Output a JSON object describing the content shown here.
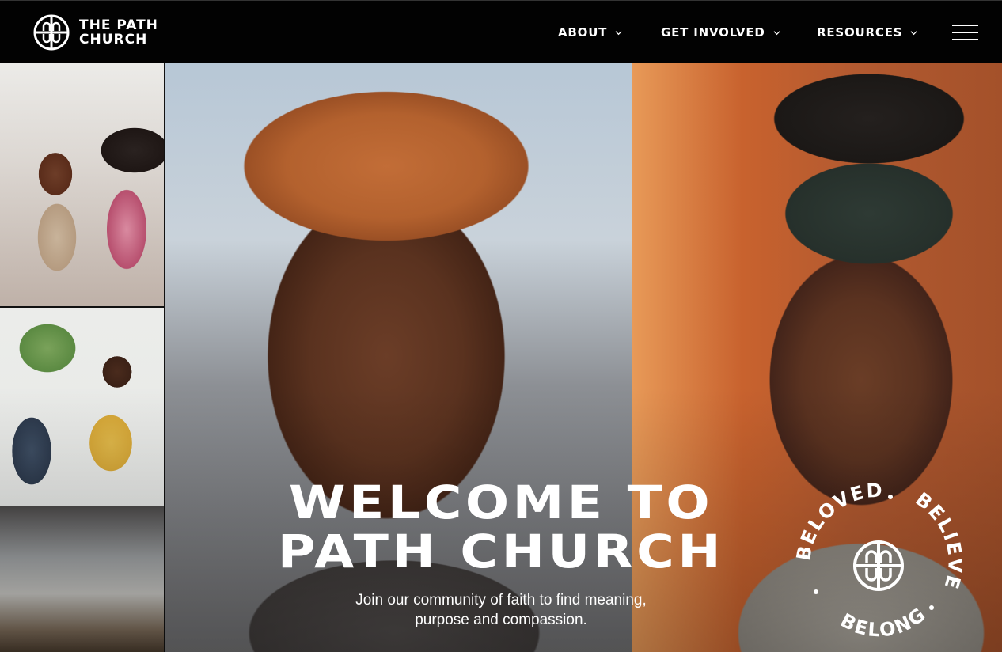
{
  "brand": {
    "name_line1": "THE PATH",
    "name_line2": "CHURCH",
    "logo_icon": "path-church-logo-icon"
  },
  "nav": {
    "items": [
      {
        "label": "ABOUT",
        "icon": "chevron-down-icon"
      },
      {
        "label": "GET INVOLVED",
        "icon": "chevron-down-icon"
      },
      {
        "label": "RESOURCES",
        "icon": "chevron-down-icon"
      }
    ],
    "menu_icon": "hamburger-menu-icon"
  },
  "hero": {
    "title_line1": "WELCOME TO",
    "title_line2": "PATH CHURCH",
    "subtitle": "Join our community of faith to find meaning, purpose and compassion."
  },
  "badge": {
    "words": [
      "BELOVED",
      "BELIEVE",
      "BELONG"
    ]
  },
  "colors": {
    "header_bg": "#020202",
    "text": "#ffffff"
  }
}
